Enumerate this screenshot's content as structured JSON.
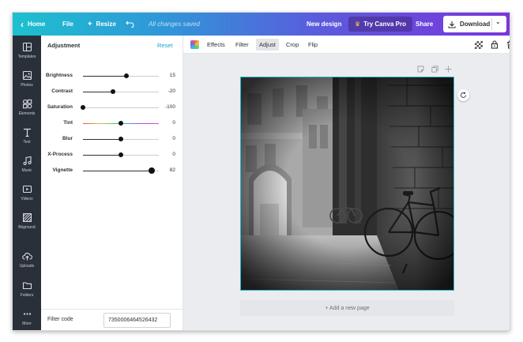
{
  "topbar": {
    "home": "Home",
    "file": "File",
    "resize": "Resize",
    "saved_status": "All changes saved",
    "new_design": "New design",
    "try_pro": "Try Canva Pro",
    "share": "Share",
    "download": "Download"
  },
  "sidebar": {
    "items": [
      {
        "label": "Templates",
        "icon": "templates-icon"
      },
      {
        "label": "Photos",
        "icon": "photos-icon"
      },
      {
        "label": "Elements",
        "icon": "elements-icon"
      },
      {
        "label": "Text",
        "icon": "text-icon"
      },
      {
        "label": "Music",
        "icon": "music-icon"
      },
      {
        "label": "Videos",
        "icon": "videos-icon"
      },
      {
        "label": "Bkground",
        "icon": "background-icon"
      },
      {
        "label": "Uploads",
        "icon": "uploads-icon"
      },
      {
        "label": "Folders",
        "icon": "folders-icon"
      },
      {
        "label": "More",
        "icon": "more-icon"
      }
    ]
  },
  "panel": {
    "title": "Adjustment",
    "reset": "Reset",
    "sliders": [
      {
        "label": "Brightness",
        "value": "15",
        "level": 15
      },
      {
        "label": "Contrast",
        "value": "-20",
        "level": -20
      },
      {
        "label": "Saturation",
        "value": "-100",
        "level": -100
      },
      {
        "label": "Tint",
        "value": "0",
        "level": 0
      },
      {
        "label": "Blur",
        "value": "0",
        "level": 0
      },
      {
        "label": "X-Process",
        "value": "0",
        "level": 0
      },
      {
        "label": "Vignette",
        "value": "82",
        "level": 82
      }
    ],
    "filter_code_label": "Filter code",
    "filter_code_value": "7350006464526432"
  },
  "edit_toolbar": {
    "effects": "Effects",
    "filter": "Filter",
    "adjust": "Adjust",
    "crop": "Crop",
    "flip": "Flip"
  },
  "canvas": {
    "add_page": "+ Add a new page"
  },
  "colors": {
    "accent": "#19a6c6",
    "selection_border": "#27b9cc",
    "sidebar_bg": "#293039"
  }
}
